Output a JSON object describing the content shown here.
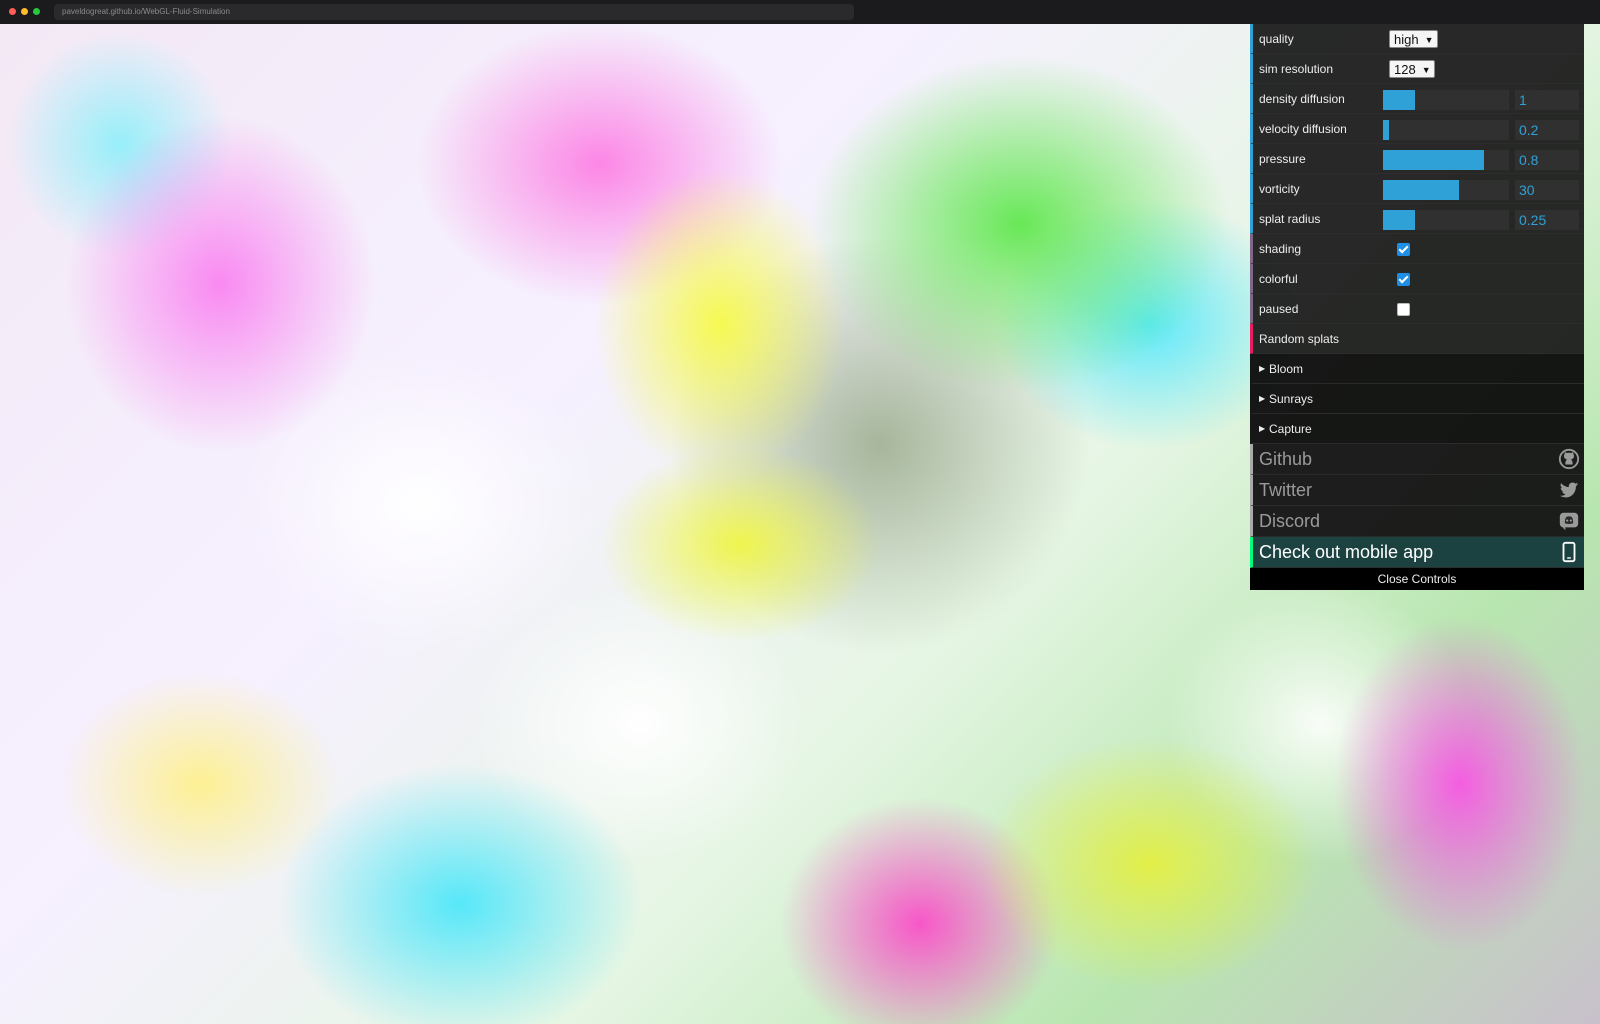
{
  "browser": {
    "url": "paveldogreat.github.io/WebGL-Fluid-Simulation",
    "traffic_colors": [
      "#ff5f57",
      "#febc2e",
      "#28c840"
    ]
  },
  "controls": {
    "quality": {
      "label": "quality",
      "value": "high"
    },
    "sim_resolution": {
      "label": "sim resolution",
      "value": "128"
    },
    "sliders": [
      {
        "label": "density diffusion",
        "value": "1",
        "fraction": 0.25
      },
      {
        "label": "velocity diffusion",
        "value": "0.2",
        "fraction": 0.05
      },
      {
        "label": "pressure",
        "value": "0.8",
        "fraction": 0.8
      },
      {
        "label": "vorticity",
        "value": "30",
        "fraction": 0.6
      },
      {
        "label": "splat radius",
        "value": "0.25",
        "fraction": 0.25
      }
    ],
    "checkboxes": [
      {
        "label": "shading",
        "checked": true
      },
      {
        "label": "colorful",
        "checked": true
      },
      {
        "label": "paused",
        "checked": false
      }
    ],
    "random_splats": "Random splats",
    "folders": [
      "Bloom",
      "Sunrays",
      "Capture"
    ],
    "links": [
      {
        "label": "Github",
        "icon": "github-icon"
      },
      {
        "label": "Twitter",
        "icon": "twitter-icon"
      },
      {
        "label": "Discord",
        "icon": "discord-icon"
      }
    ],
    "mobile_app": {
      "label": "Check out mobile app",
      "icon": "phone-icon"
    },
    "close": "Close Controls",
    "accent_color": "#2fa1d6"
  }
}
